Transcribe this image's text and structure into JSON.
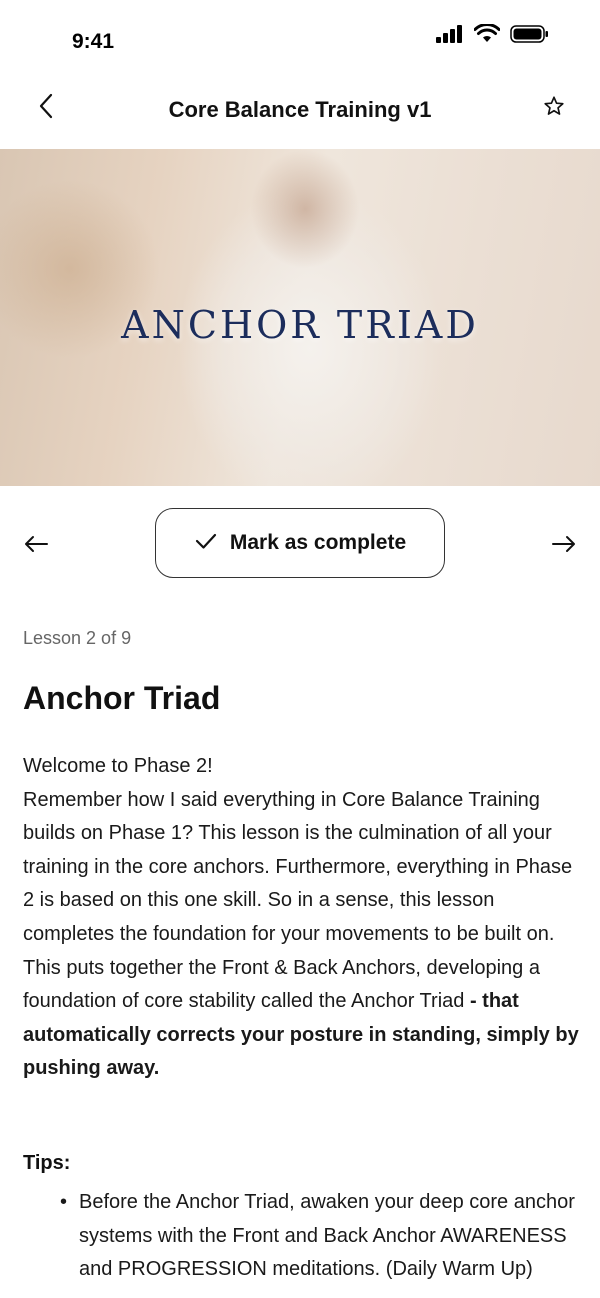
{
  "status_bar": {
    "time": "9:41",
    "icons": [
      "cellular-signal-icon",
      "wifi-icon",
      "battery-icon"
    ]
  },
  "nav": {
    "title": "Core Balance Training v1",
    "back_icon": "chevron-left-icon",
    "favorite_icon": "star-outline-icon"
  },
  "video": {
    "overlay_title": "ANCHOR TRIAD",
    "title_color": "#1c2d5c"
  },
  "lesson_nav": {
    "prev_icon": "arrow-left-icon",
    "next_icon": "arrow-right-icon",
    "complete_icon": "checkmark-icon",
    "complete_label": "Mark as complete"
  },
  "lesson": {
    "count": "Lesson 2 of 9",
    "title": "Anchor Triad",
    "paragraphs": [
      "Welcome to Phase 2!",
      "Remember how I said everything in Core Balance Training builds on Phase 1? This lesson is the culmination of all your training in the core anchors. Furthermore, everything in Phase 2 is based on this one skill. So in a sense, this lesson completes the foundation for your movements to be built on."
    ],
    "para3_normal": "This puts together the Front & Back Anchors, developing a foundation of core stability called the Anchor Triad",
    "para3_bold": " - that automatically corrects your posture in standing, simply by pushing away.",
    "tips_heading": "Tips:",
    "tips": [
      "Before the Anchor Triad, awaken your deep core anchor systems with the Front and Back Anchor AWARENESS and PROGRESSION meditations. (Daily Warm Up)"
    ]
  }
}
